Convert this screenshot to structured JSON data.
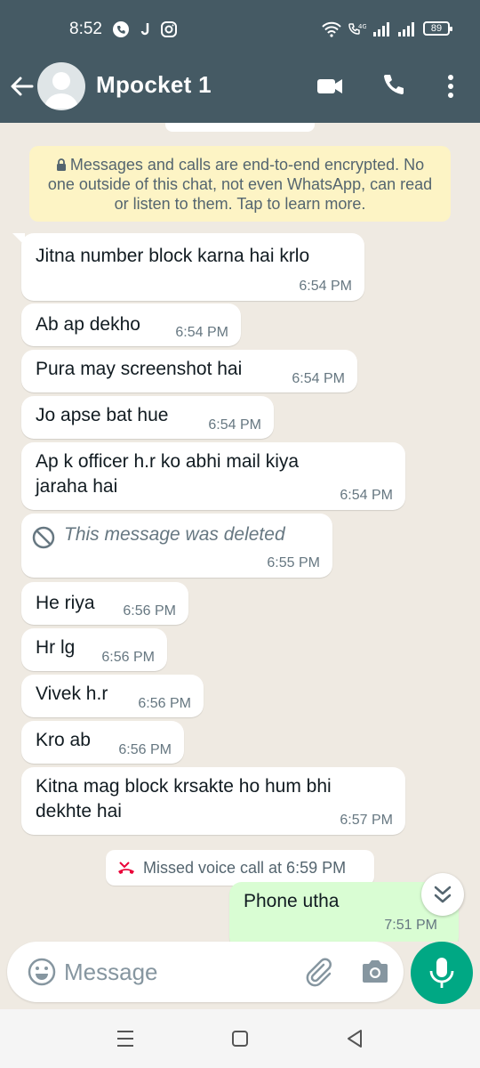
{
  "status_bar": {
    "time": "8:52",
    "battery": "89",
    "icons": [
      "phone-call-icon",
      "j-app-icon",
      "instagram-icon",
      "wifi-icon",
      "volte-icon",
      "signal-icon",
      "signal-icon-2"
    ]
  },
  "header": {
    "contact_name": "Mpocket 1",
    "icons": [
      "back-arrow-icon",
      "avatar",
      "video-call-icon",
      "voice-call-icon",
      "more-vert-icon"
    ],
    "bg_color": "#455a64"
  },
  "encryption_notice": "Messages and calls are end-to-end encrypted. No one outside of this chat, not even WhatsApp, can read or listen to them. Tap to learn more.",
  "messages": [
    {
      "text": "Jitna number block karna hai krlo",
      "time": "6:54 PM"
    },
    {
      "text": "Ab ap dekho",
      "time": "6:54 PM"
    },
    {
      "text": "Pura may screenshot hai",
      "time": "6:54 PM"
    },
    {
      "text": "Jo apse bat hue",
      "time": "6:54 PM"
    },
    {
      "text": "Ap k officer h.r ko abhi mail kiya jaraha hai",
      "time": "6:54 PM"
    },
    {
      "text": "This message was deleted",
      "time": "6:55 PM",
      "deleted": true
    },
    {
      "text": "He riya",
      "time": "6:56 PM"
    },
    {
      "text": "Hr lg",
      "time": "6:56 PM"
    },
    {
      "text": "Vivek h.r",
      "time": "6:56 PM"
    },
    {
      "text": "Kro ab",
      "time": "6:56 PM"
    },
    {
      "text": "Kitna mag block krsakte ho hum bhi dekhte hai",
      "time": "6:57 PM"
    }
  ],
  "missed_call": "Missed voice call at 6:59 PM",
  "outgoing": {
    "text": "Phone utha",
    "time": "7:51 PM"
  },
  "input": {
    "placeholder": "Message"
  },
  "colors": {
    "accent": "#00a884",
    "outgoing_bubble": "#d9fdd3",
    "chat_bg": "#efeae2",
    "encryption_bg": "#fdf4c5"
  }
}
